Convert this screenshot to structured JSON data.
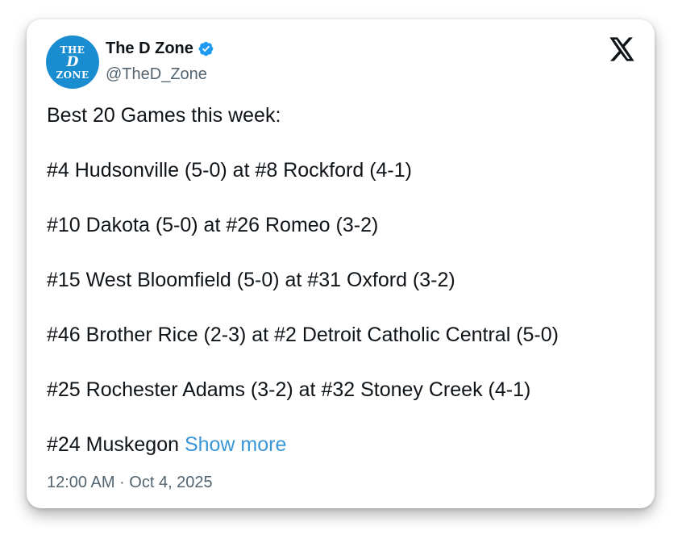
{
  "author": {
    "avatar_text_top": "THE",
    "avatar_text_mid": "D",
    "avatar_text_bottom": "ZONE",
    "display_name": "The D Zone",
    "handle": "@TheD_Zone",
    "verified": true
  },
  "platform_icon": "x-logo-icon",
  "tweet": {
    "lines": [
      "Best 20 Games this week:",
      "#4 Hudsonville (5-0) at #8 Rockford (4-1)",
      "#10 Dakota (5-0) at #26 Romeo (3-2)",
      "#15 West Bloomfield (5-0) at #31 Oxford (3-2)",
      "#46 Brother Rice (2-3) at #2 Detroit Catholic Central (5-0)",
      "#25 Rochester Adams (3-2) at #32 Stoney Creek (4-1)"
    ],
    "last_line_text": "#24 Muskegon",
    "show_more_label": "Show more"
  },
  "timestamp": "12:00 AM · Oct 4, 2025",
  "colors": {
    "avatar_bg": "#1a8dd0",
    "verified_badge": "#1d9bf0",
    "link": "#3a96d6",
    "text": "#0f1419",
    "muted": "#536471"
  }
}
